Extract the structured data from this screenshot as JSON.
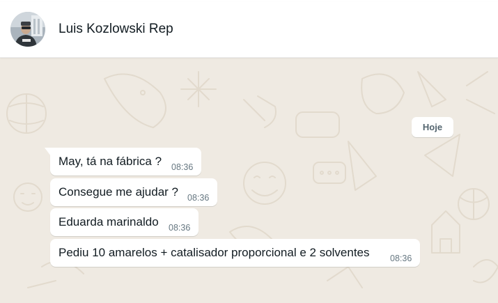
{
  "header": {
    "contact_name": "Luis Kozlowski Rep",
    "avatar_icon": "profile-photo"
  },
  "chat": {
    "date_divider": "Hoje",
    "messages": [
      {
        "text": "May, tá na fábrica ?",
        "time": "08:36",
        "direction": "incoming"
      },
      {
        "text": "Consegue me ajudar ?",
        "time": "08:36",
        "direction": "incoming"
      },
      {
        "text": "Eduarda marinaldo",
        "time": "08:36",
        "direction": "incoming"
      },
      {
        "text": "Pediu 10 amarelos + catalisador proporcional e 2 solventes",
        "time": "08:36",
        "direction": "incoming"
      }
    ]
  },
  "colors": {
    "chat_background": "#efeae2",
    "bubble_incoming": "#ffffff",
    "text_primary": "#111b21",
    "text_secondary": "#667781",
    "doodle": "#e2dacd"
  }
}
